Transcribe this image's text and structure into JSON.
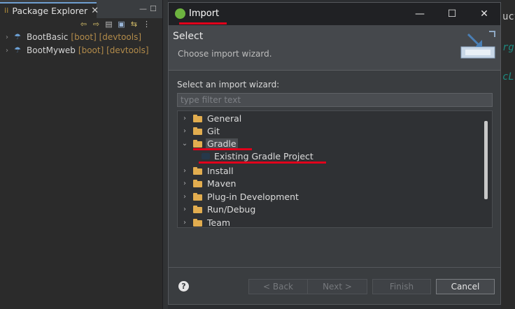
{
  "explorer": {
    "tab_label": "Package Explorer",
    "close_glyph": "✕",
    "projects": [
      {
        "name": "BootBasic",
        "decoration": "[boot] [devtools]"
      },
      {
        "name": "BootMyweb",
        "decoration": "[boot] [devtools]"
      }
    ]
  },
  "editor": {
    "fragments": [
      "uctD",
      "rg",
      "cL"
    ]
  },
  "dialog": {
    "title": "Import",
    "banner_heading": "Select",
    "banner_description": "Choose import wizard.",
    "select_label": "Select an import wizard:",
    "filter_placeholder": "type filter text",
    "wizards": [
      {
        "label": "General",
        "expanded": false
      },
      {
        "label": "Git",
        "expanded": false
      },
      {
        "label": "Gradle",
        "expanded": true,
        "selected": true
      },
      {
        "label": "Install",
        "expanded": false
      },
      {
        "label": "Maven",
        "expanded": false
      },
      {
        "label": "Plug-in Development",
        "expanded": false
      },
      {
        "label": "Run/Debug",
        "expanded": false
      },
      {
        "label": "Team",
        "expanded": false
      }
    ],
    "gradle_child": "Existing Gradle Project",
    "buttons": {
      "back": "< Back",
      "next": "Next >",
      "finish": "Finish",
      "cancel": "Cancel"
    },
    "help_glyph": "?"
  },
  "colors": {
    "annotation_red": "#e0001b",
    "spring_green": "#6db33f",
    "folder": "#e2ad4f"
  }
}
